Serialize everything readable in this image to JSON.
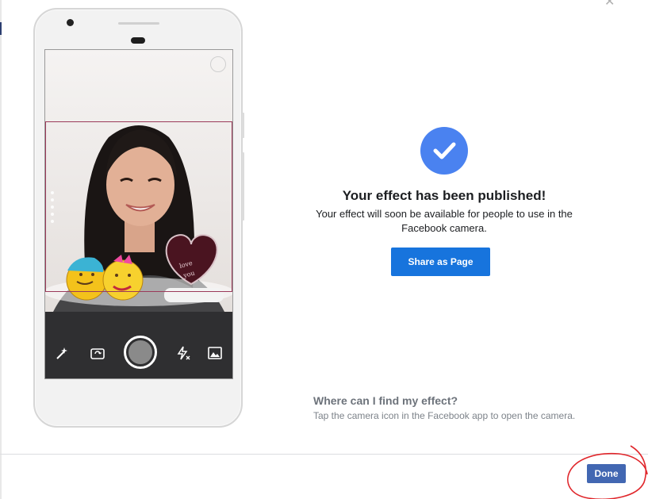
{
  "dialog": {
    "close_icon": "close-icon",
    "published": {
      "icon": "checkmark-icon",
      "title": "Your effect has been published!",
      "message": "Your effect will soon be available for people to use in the Facebook camera.",
      "share_button_label": "Share as Page"
    },
    "help": {
      "heading": "Where can I find my effect?",
      "text": "Tap the camera icon in the Facebook app to open the camera."
    },
    "footer": {
      "done_label": "Done"
    }
  },
  "phone_preview": {
    "sticker_text": "love you",
    "toolbar_icons": [
      "magic-wand-icon",
      "flip-camera-icon",
      "shutter-button",
      "flash-icon",
      "gallery-icon"
    ]
  },
  "colors": {
    "accent": "#1774dd",
    "done": "#4267b2",
    "check": "#4a82f0",
    "annotation": "#e0262b"
  }
}
